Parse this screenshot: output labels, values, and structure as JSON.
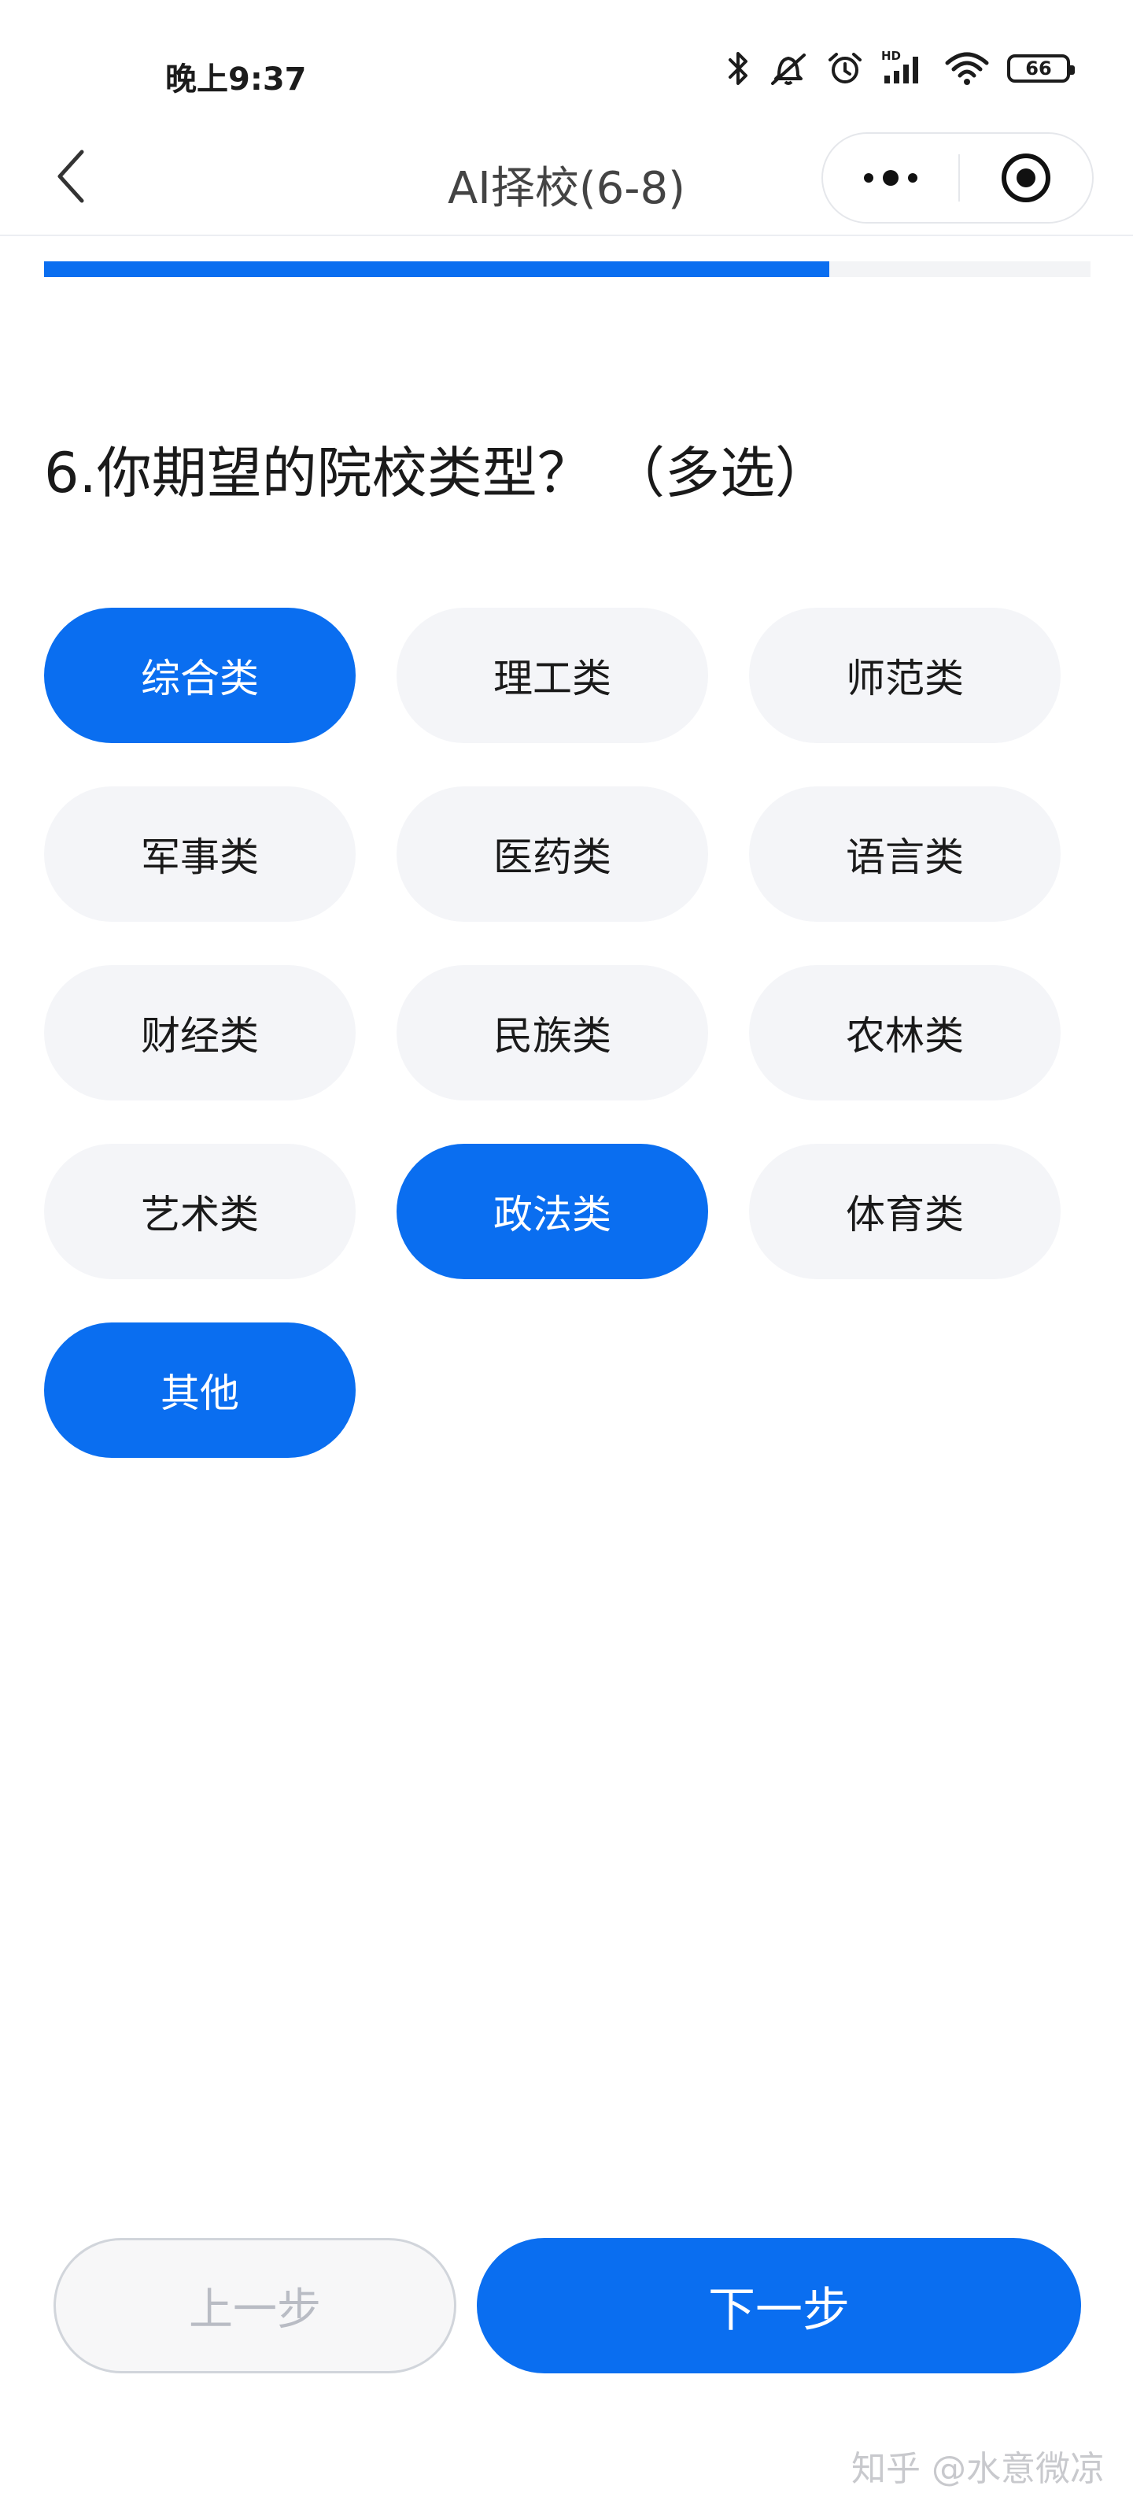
{
  "status_bar": {
    "time": "晚上9:37",
    "battery": "66",
    "icons": [
      "bluetooth-icon",
      "mute-icon",
      "alarm-icon",
      "hd-signal-icon",
      "wifi-icon",
      "battery-icon"
    ],
    "hd_label": "HD"
  },
  "nav": {
    "title": "AI择校(6-8)",
    "back_icon": "chevron-left-icon",
    "more_icon": "more-dots-icon",
    "close_icon": "target-close-icon"
  },
  "progress": {
    "fraction": 0.75,
    "fill_color": "#0a6ef0"
  },
  "question": {
    "title": "6.你期望的院校类型？ （多选）"
  },
  "options": [
    {
      "label": "综合类",
      "selected": true
    },
    {
      "label": "理工类",
      "selected": false
    },
    {
      "label": "师范类",
      "selected": false
    },
    {
      "label": "军事类",
      "selected": false
    },
    {
      "label": "医药类",
      "selected": false
    },
    {
      "label": "语言类",
      "selected": false
    },
    {
      "label": "财经类",
      "selected": false
    },
    {
      "label": "民族类",
      "selected": false
    },
    {
      "label": "农林类",
      "selected": false
    },
    {
      "label": "艺术类",
      "selected": false
    },
    {
      "label": "政法类",
      "selected": true
    },
    {
      "label": "体育类",
      "selected": false
    },
    {
      "label": "其他",
      "selected": true
    }
  ],
  "buttons": {
    "prev": "上一步",
    "next": "下一步"
  },
  "watermark": "知乎 @水意微凉",
  "colors": {
    "accent": "#0a6ef0",
    "option_bg": "#f4f5f8"
  }
}
